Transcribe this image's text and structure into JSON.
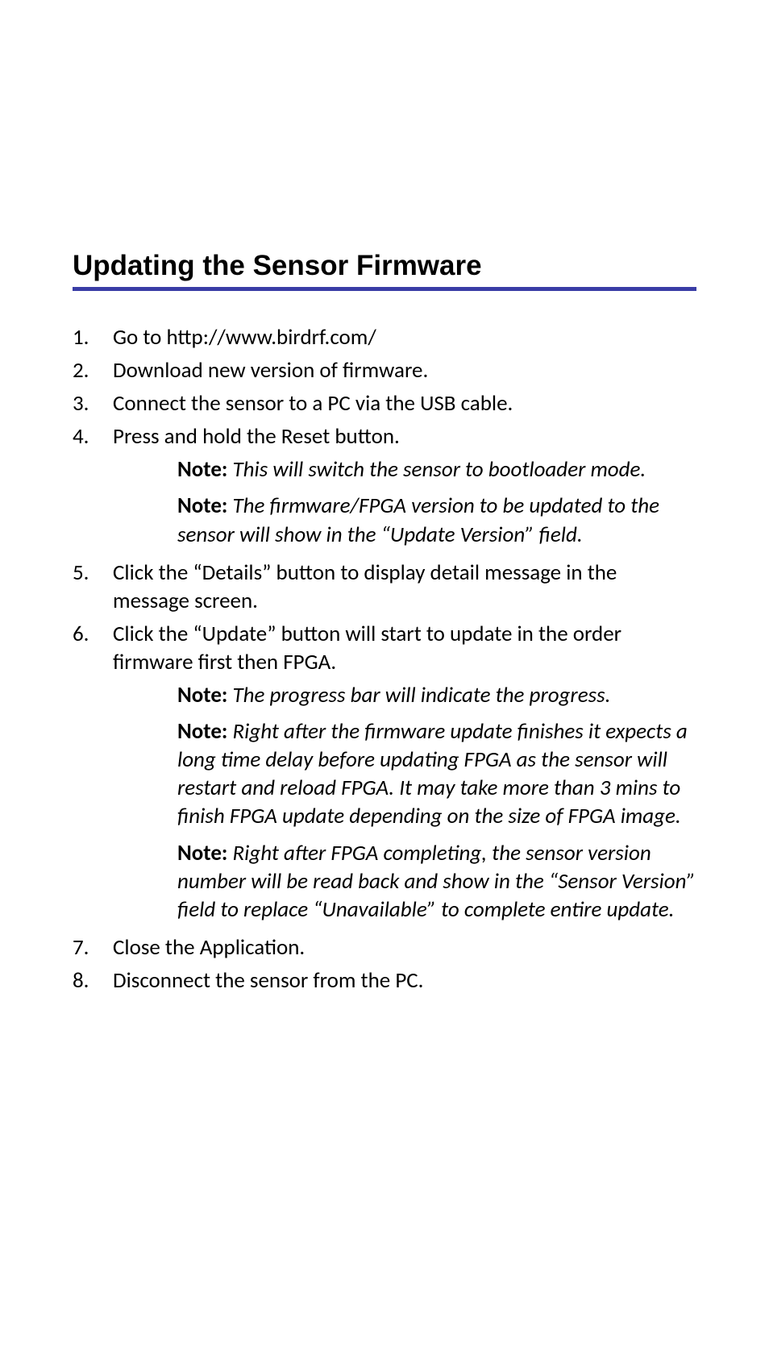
{
  "heading": "Updating the Sensor Firmware",
  "steps": [
    {
      "num": "1.",
      "text": "Go to http://www.birdrf.com/",
      "notes": []
    },
    {
      "num": "2.",
      "text": "Download new version of firmware.",
      "notes": []
    },
    {
      "num": "3.",
      "text": "Connect the sensor to a PC via the USB cable.",
      "notes": []
    },
    {
      "num": "4.",
      "text": "Press and hold the Reset button.",
      "notes": [
        "This will switch the sensor to bootloader mode.",
        "The firmware/FPGA version to be updated to the sensor will show in the “Update Version” field."
      ]
    },
    {
      "num": "5.",
      "text": "Click the “Details” button to display detail message in the message screen.",
      "notes": []
    },
    {
      "num": "6.",
      "text": "Click the “Update” button will start to update in the order firmware first then FPGA.",
      "notes": [
        "The progress bar will indicate the progress.",
        "Right after the firmware update finishes it expects a long time delay before updating FPGA as the sensor will restart and reload FPGA. It may take more than 3 mins to finish FPGA update depending on the size of FPGA image.",
        "Right after FPGA completing, the sensor version number will be read back and show in the “Sensor Version” field to replace “Unavailable” to complete entire update."
      ]
    },
    {
      "num": "7.",
      "text": "Close the Application.",
      "notes": []
    },
    {
      "num": "8.",
      "text": "Disconnect the sensor from the PC.",
      "notes": []
    }
  ],
  "noteLabel": "Note:"
}
